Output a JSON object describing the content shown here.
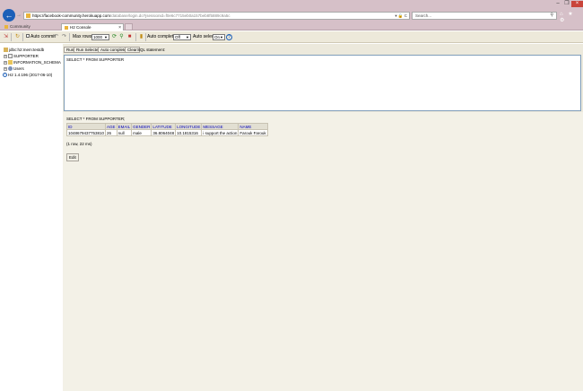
{
  "browser": {
    "url_prefix": "https://",
    "url_host": "facebook-community.herokuapp.com",
    "url_path": "/database/login.do?jsessionid=f0e6c7715eb0a157beb8f5889c9a5c",
    "url_tools": "▾ 🔒 C",
    "search_placeholder": "Search...",
    "tabs": [
      {
        "label": "Community"
      },
      {
        "label": "H2 Console",
        "close": "×"
      }
    ],
    "window_buttons": {
      "min": "–",
      "max": "❐",
      "close": "×"
    },
    "nav_icons": "⌂ ★ ⚙"
  },
  "toolbar": {
    "auto_commit_label": "Auto commit",
    "max_rows_label": "Max rows:",
    "max_rows_value": "1000",
    "auto_complete_label": "Auto complete",
    "auto_complete_value": "Off",
    "auto_select_label": "Auto select",
    "auto_select_value": "On"
  },
  "tree": {
    "items": [
      {
        "label": "jdbc:h2:mem:testdb"
      },
      {
        "label": "SUPPORTER"
      },
      {
        "label": "INFORMATION_SCHEMA"
      },
      {
        "label": "Users"
      },
      {
        "label": "H2 1.4.196 (2017-06-10)"
      }
    ]
  },
  "query": {
    "buttons": [
      "Run",
      "Run Selected",
      "Auto complete",
      "Clear"
    ],
    "sql_label": "SQL statement:",
    "sql_text": "SELECT * FROM SUPPORTER"
  },
  "result": {
    "title": "SELECT * FROM SUPPORTER;",
    "columns": [
      "ID",
      "AGE",
      "EMAIL",
      "GENDER",
      "LATITUDE",
      "LONGITUDE",
      "MESSAGE",
      "NAME"
    ],
    "rows": [
      [
        "1048679437753810",
        "26",
        "null",
        "male",
        "36.8064048",
        "10.1815316",
        "i support the action",
        "Farouk Farouk"
      ]
    ],
    "rows_info": "(1 row, 22 ms)",
    "edit_label": "Edit"
  }
}
